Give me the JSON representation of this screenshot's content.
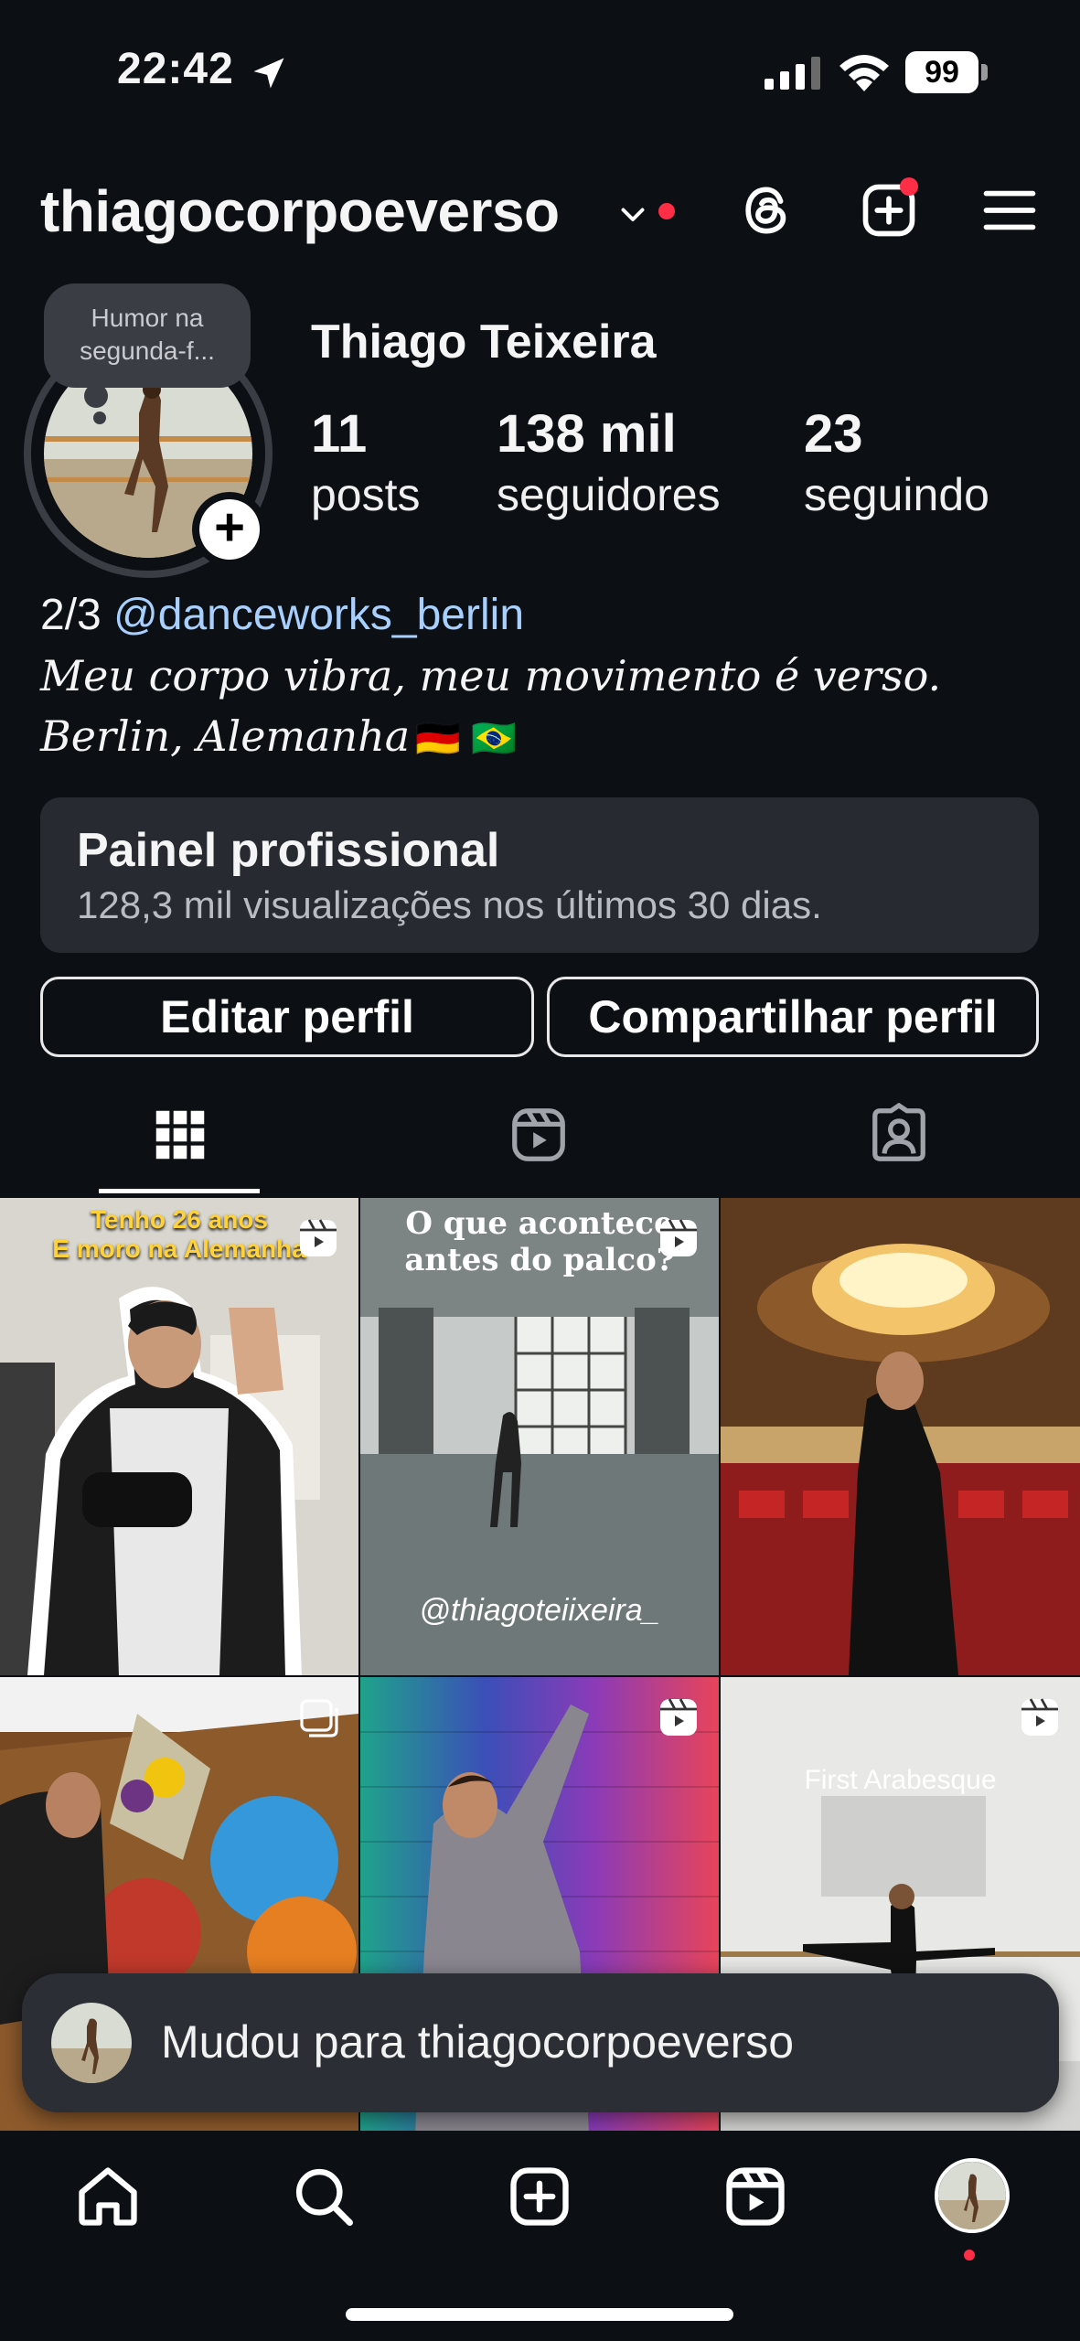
{
  "status_bar": {
    "time": "22:42",
    "battery": "99"
  },
  "header": {
    "username": "thiagocorpoeverso"
  },
  "profile": {
    "note": "Humor na segunda-f...",
    "full_name": "Thiago Teixeira",
    "stats": [
      {
        "value": "11",
        "label": "posts"
      },
      {
        "value": "138 mil",
        "label": "seguidores"
      },
      {
        "value": "23",
        "label": "seguindo"
      }
    ],
    "bio_prefix": "2/3 ",
    "bio_mention": "@danceworks_berlin",
    "bio_line2": "Meu corpo vibra, meu movimento é verso.",
    "bio_line3": "Berlin, Alemanha",
    "bio_flags": "🇩🇪 🇧🇷"
  },
  "pro_panel": {
    "title": "Painel profissional",
    "subtitle": "128,3 mil visualizações nos últimos 30 dias."
  },
  "buttons": {
    "edit": "Editar perfil",
    "share": "Compartilhar perfil"
  },
  "posts": [
    {
      "caption_line1": "Tenho 26 anos",
      "caption_line2": "E moro na Alemanha",
      "type": "reel"
    },
    {
      "caption_line1": "O que acontece",
      "caption_line2": "antes do palco?",
      "watermark": "@thiagoteiixeira_",
      "type": "reel"
    },
    {
      "type": "photo"
    },
    {
      "type": "carousel"
    },
    {
      "type": "reel"
    },
    {
      "caption_line1": "First Arabesque",
      "type": "reel"
    }
  ],
  "toast": {
    "message": "Mudou para thiagocorpoeverso"
  },
  "colors": {
    "background": "#0c0f14",
    "notification_dot": "#ff2d46",
    "mention": "#a8d0ff",
    "panel": "#272a31"
  }
}
